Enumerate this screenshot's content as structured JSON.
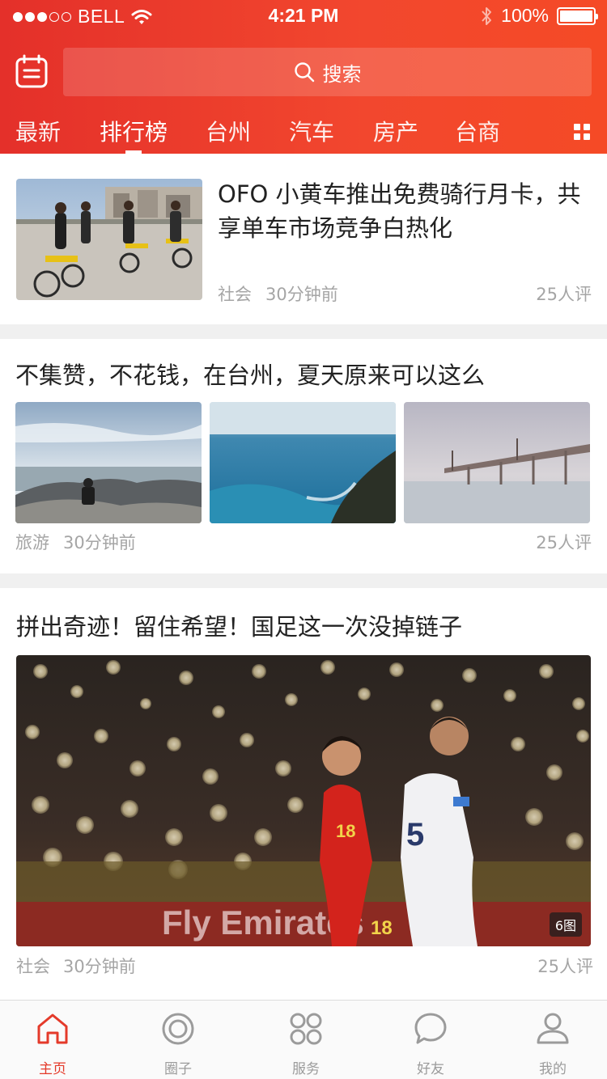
{
  "status_bar": {
    "carrier": "BELL",
    "time": "4:21 PM",
    "battery": "100%"
  },
  "search": {
    "label": "搜索"
  },
  "tabs": [
    "最新",
    "排行榜",
    "台州",
    "汽车",
    "房产",
    "台商"
  ],
  "articles": [
    {
      "title": "OFO 小黄车推出免费骑行月卡，共享单车市场竞争白热化",
      "category": "社会",
      "time": "30分钟前",
      "comments": "25人评"
    },
    {
      "title": "不集赞，不花钱，在台州，夏天原来可以这么",
      "category": "旅游",
      "time": "30分钟前",
      "comments": "25人评"
    },
    {
      "title": "拼出奇迹！留住希望！国足这一次没掉链子",
      "category": "社会",
      "time": "30分钟前",
      "comments": "25人评",
      "image_count": "6图"
    }
  ],
  "bottom_nav": [
    "主页",
    "圈子",
    "服务",
    "好友",
    "我的"
  ],
  "colors": {
    "brand": "#e4302a",
    "nav_active": "#e43a2a",
    "nav_inactive": "#9b9b9b"
  }
}
